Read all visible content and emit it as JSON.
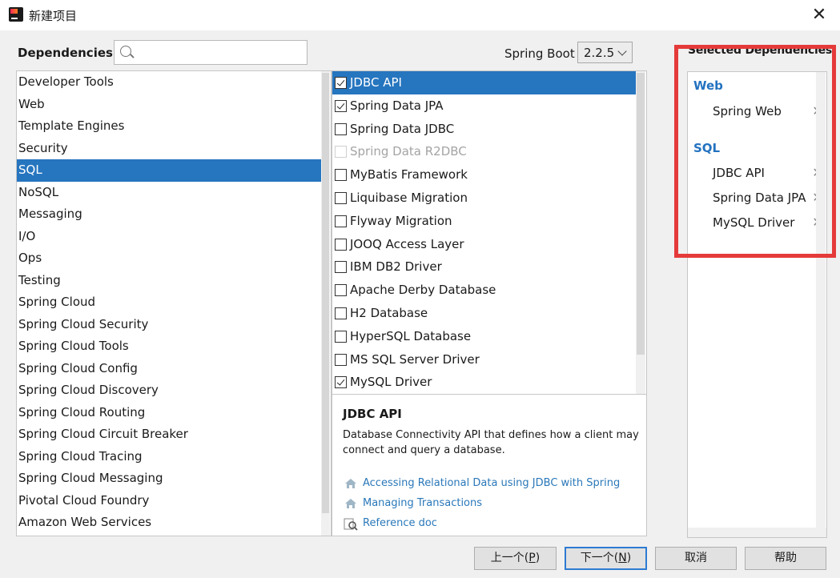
{
  "window": {
    "title": "新建项目",
    "close_icon": "close-icon"
  },
  "dependencies": {
    "label": "Dependencies",
    "search": {
      "value": "",
      "placeholder": ""
    },
    "spring_boot_label": "Spring Boot",
    "spring_boot_version": "2.2.5"
  },
  "categories": [
    "Developer Tools",
    "Web",
    "Template Engines",
    "Security",
    "SQL",
    "NoSQL",
    "Messaging",
    "I/O",
    "Ops",
    "Testing",
    "Spring Cloud",
    "Spring Cloud Security",
    "Spring Cloud Tools",
    "Spring Cloud Config",
    "Spring Cloud Discovery",
    "Spring Cloud Routing",
    "Spring Cloud Circuit Breaker",
    "Spring Cloud Tracing",
    "Spring Cloud Messaging",
    "Pivotal Cloud Foundry",
    "Amazon Web Services"
  ],
  "selected_category": "SQL",
  "sql_deps": [
    {
      "label": "JDBC API",
      "checked": true,
      "selected": true,
      "disabled": false
    },
    {
      "label": "Spring Data JPA",
      "checked": true,
      "selected": false,
      "disabled": false
    },
    {
      "label": "Spring Data JDBC",
      "checked": false,
      "selected": false,
      "disabled": false
    },
    {
      "label": "Spring Data R2DBC",
      "checked": false,
      "selected": false,
      "disabled": true
    },
    {
      "label": "MyBatis Framework",
      "checked": false,
      "selected": false,
      "disabled": false
    },
    {
      "label": "Liquibase Migration",
      "checked": false,
      "selected": false,
      "disabled": false
    },
    {
      "label": "Flyway Migration",
      "checked": false,
      "selected": false,
      "disabled": false
    },
    {
      "label": "JOOQ Access Layer",
      "checked": false,
      "selected": false,
      "disabled": false
    },
    {
      "label": "IBM DB2 Driver",
      "checked": false,
      "selected": false,
      "disabled": false
    },
    {
      "label": "Apache Derby Database",
      "checked": false,
      "selected": false,
      "disabled": false
    },
    {
      "label": "H2 Database",
      "checked": false,
      "selected": false,
      "disabled": false
    },
    {
      "label": "HyperSQL Database",
      "checked": false,
      "selected": false,
      "disabled": false
    },
    {
      "label": "MS SQL Server Driver",
      "checked": false,
      "selected": false,
      "disabled": false
    },
    {
      "label": "MySQL Driver",
      "checked": true,
      "selected": false,
      "disabled": false
    }
  ],
  "description": {
    "title": "JDBC API",
    "text": "Database Connectivity API that defines how a client may connect and query a database.",
    "links": [
      {
        "label": "Accessing Relational Data using JDBC with Spring",
        "icon": "guide-house-icon"
      },
      {
        "label": "Managing Transactions",
        "icon": "guide-house-icon"
      },
      {
        "label": "Reference doc",
        "icon": "reference-doc-icon"
      }
    ]
  },
  "selected_dependencies": {
    "header": "Selected Dependencies",
    "groups": [
      {
        "name": "Web",
        "items": [
          "Spring Web"
        ]
      },
      {
        "name": "SQL",
        "items": [
          "JDBC API",
          "Spring Data JPA",
          "MySQL Driver"
        ]
      }
    ],
    "remove_glyph": "✕",
    "highlight_color": "#e53a3a"
  },
  "buttons": {
    "prev": {
      "label": "上一个(",
      "mnemonic": "P",
      "suffix": ")"
    },
    "next": {
      "label": "下一个(",
      "mnemonic": "N",
      "suffix": ")"
    },
    "cancel": "取消",
    "help": "帮助"
  },
  "colors": {
    "selection": "#2675bf",
    "link": "#2a78b9",
    "group": "#2372c0"
  }
}
